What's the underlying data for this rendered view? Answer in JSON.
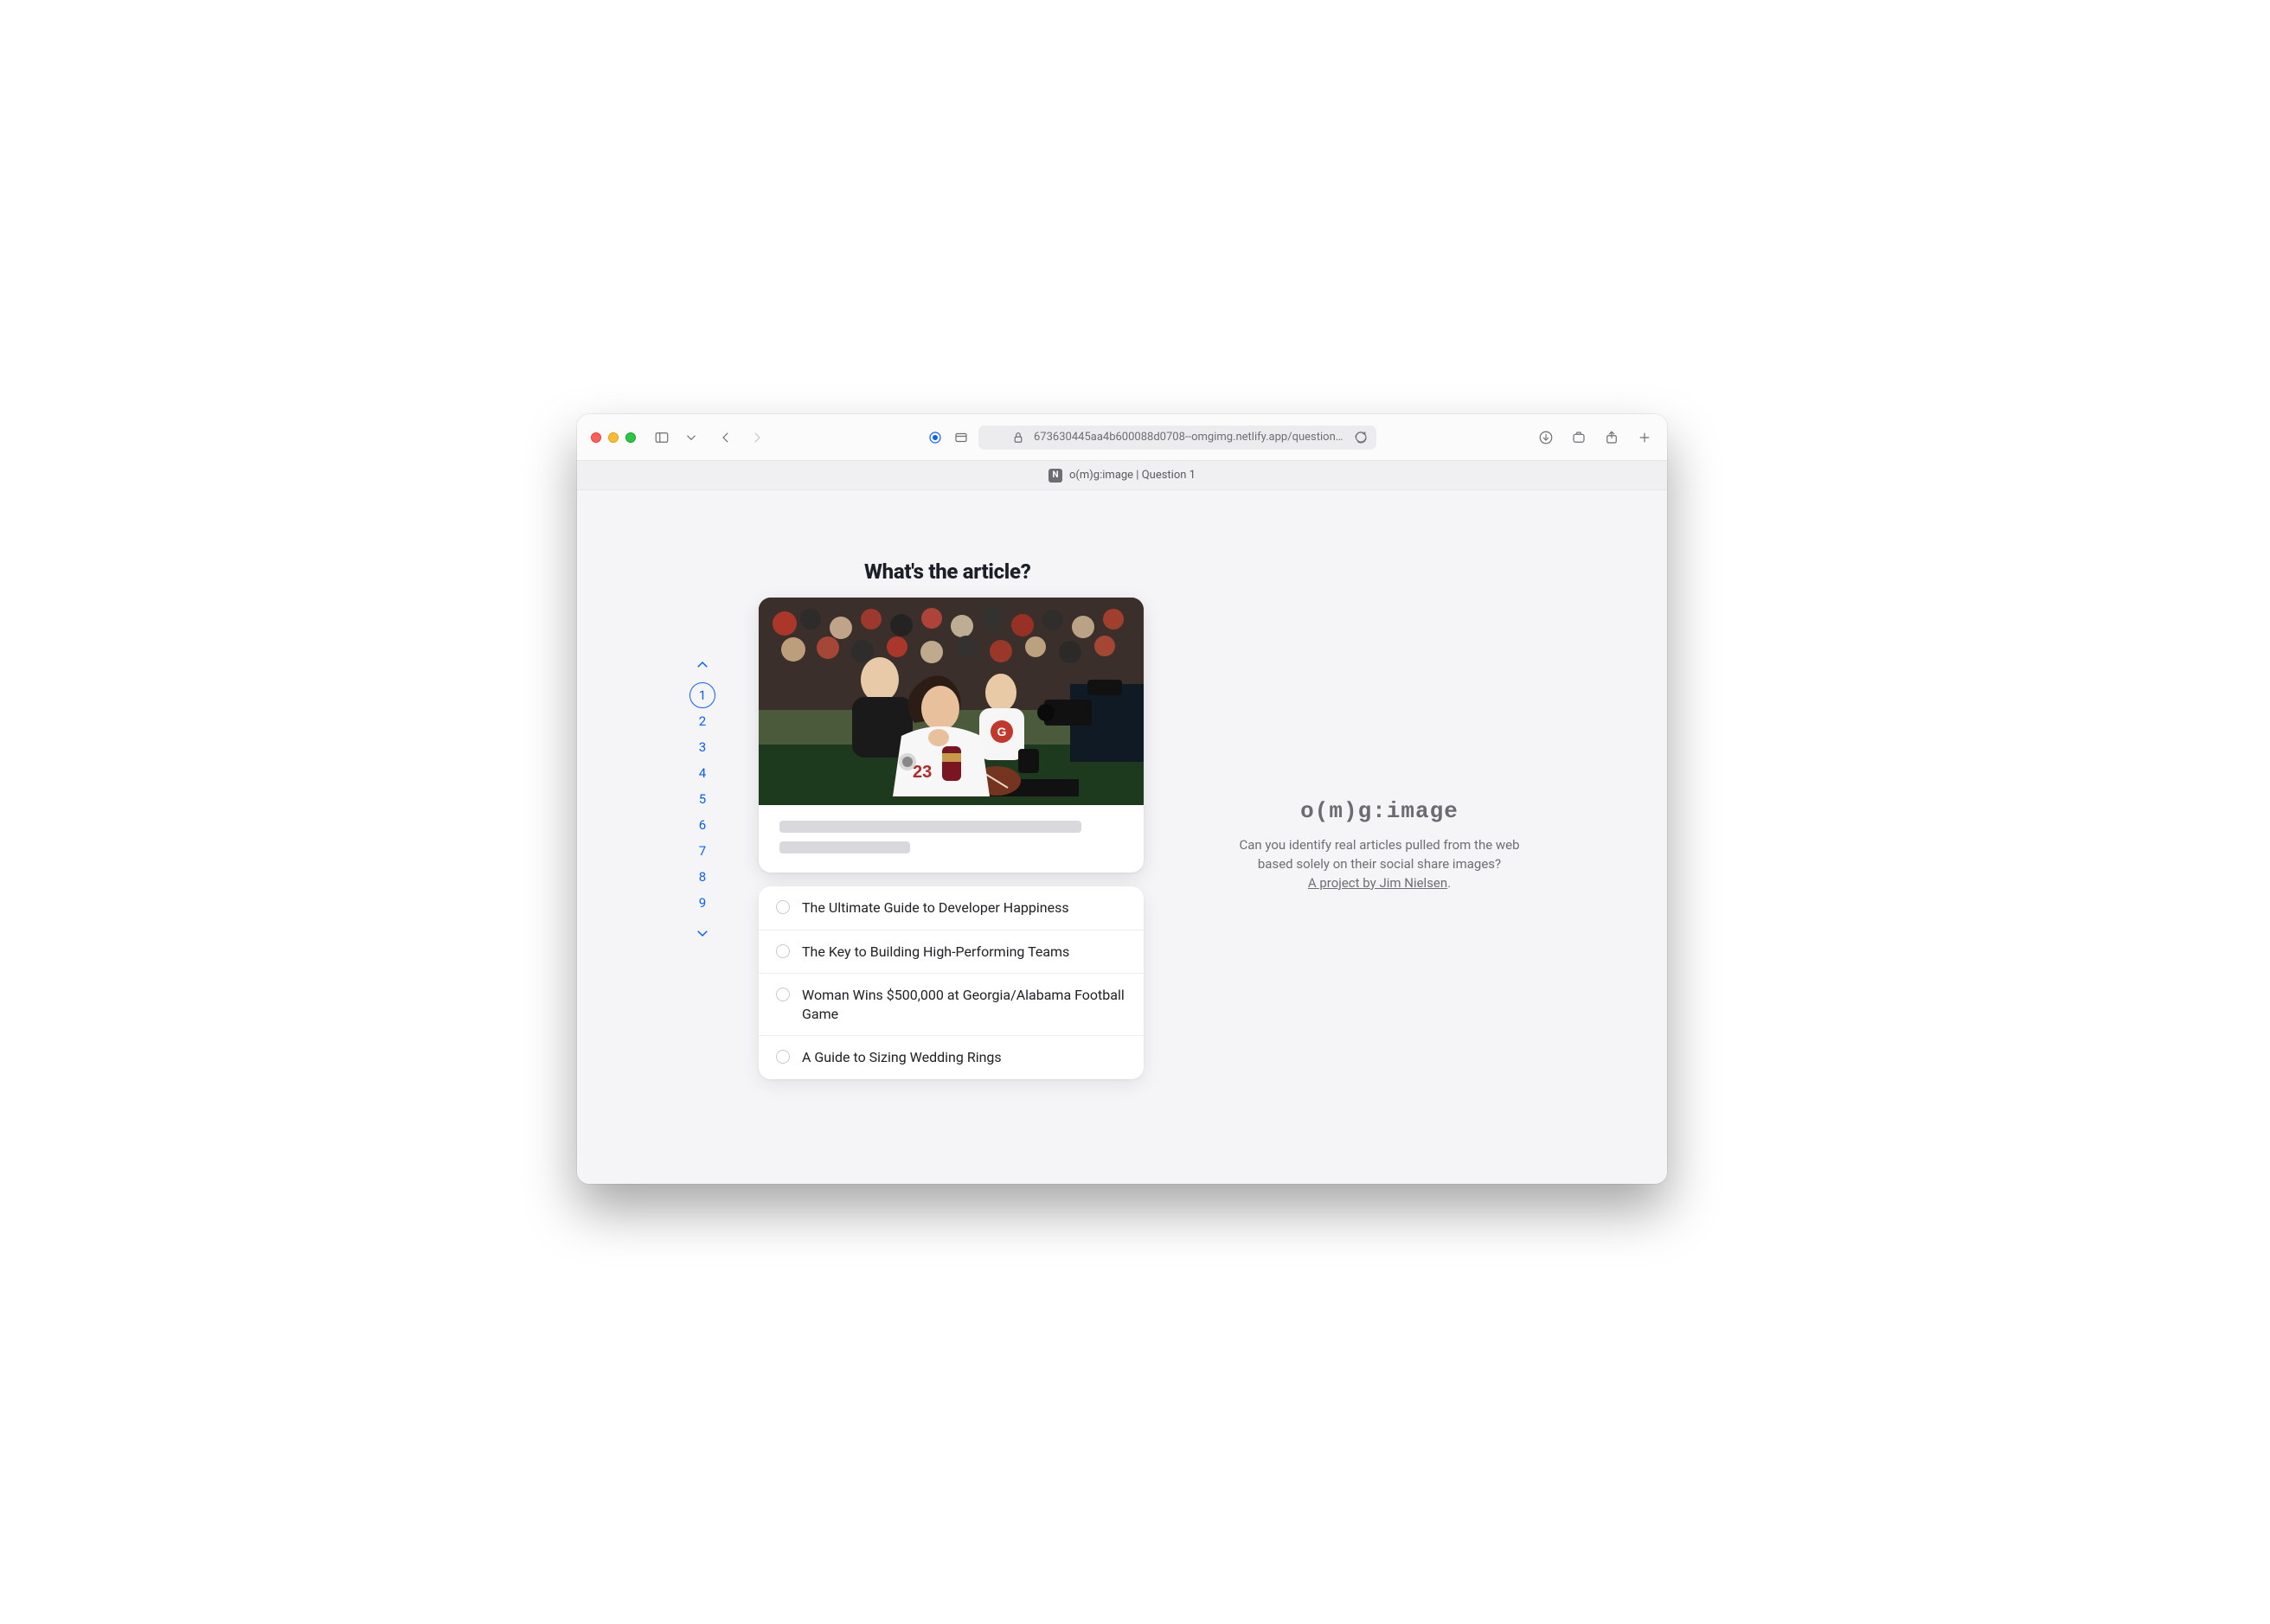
{
  "browser": {
    "url": "673630445aa4b600088d0708--omgimg.netlify.app/questions/",
    "tab_title": "o(m)g:image | Question 1",
    "favicon_letter": "N"
  },
  "nav": {
    "items": [
      "1",
      "2",
      "3",
      "4",
      "5",
      "6",
      "7",
      "8",
      "9"
    ],
    "active_index": 0
  },
  "question": {
    "title": "What's the article?",
    "answers": [
      "The Ultimate Guide to Developer Happiness",
      "The Key to Building High-Performing Teams",
      "Woman Wins $500,000 at Georgia/Alabama Football Game",
      "A Guide to Sizing Wedding Rings"
    ]
  },
  "sidebar": {
    "logo": "o(m)g:image",
    "tagline_1": "Can you identify real articles pulled from the web based solely on their social share images?",
    "project_link_text": "A project by Jim Nielsen",
    "period": "."
  }
}
